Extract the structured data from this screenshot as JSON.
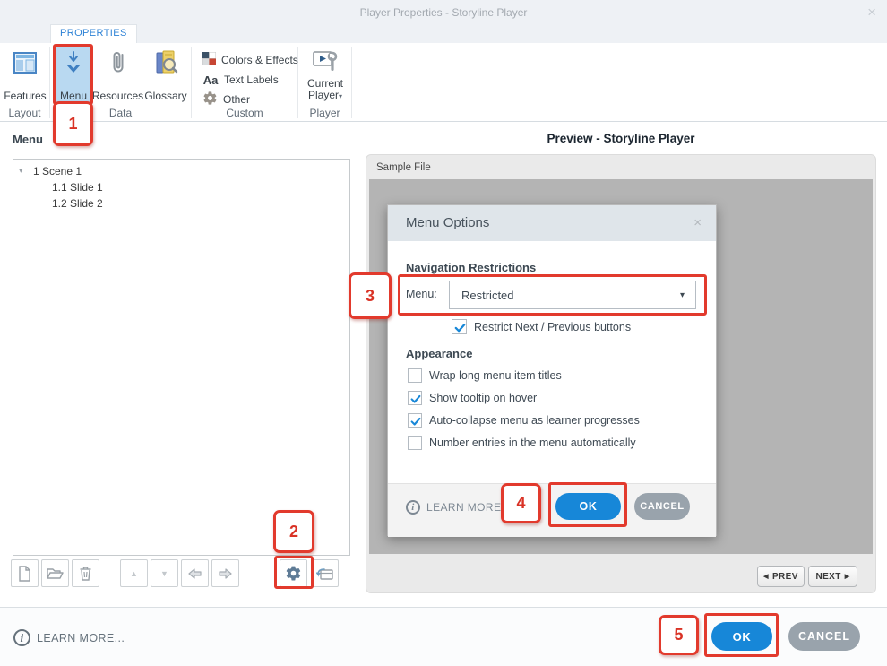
{
  "titlebar": {
    "title": "Player Properties - Storyline Player"
  },
  "ribbon": {
    "tab": "PROPERTIES",
    "features": "Features",
    "menu": "Menu",
    "resources": "Resources",
    "glossary": "Glossary",
    "colors_effects": "Colors & Effects",
    "text_labels": "Text Labels",
    "other": "Other",
    "current_player_line1": "Current",
    "current_player_line2": "Player",
    "groups": {
      "layout": "Layout",
      "data": "Data",
      "custom": "Custom",
      "player": "Player"
    }
  },
  "menu_panel": {
    "heading": "Menu",
    "tree": [
      {
        "label": "1 Scene 1"
      },
      {
        "label": "1.1 Slide 1"
      },
      {
        "label": "1.2 Slide 2"
      }
    ]
  },
  "preview": {
    "heading": "Preview - Storyline Player",
    "sample_file": "Sample File",
    "prev": "PREV",
    "next": "NEXT"
  },
  "dialog": {
    "title": "Menu Options",
    "nav_heading": "Navigation Restrictions",
    "menu_label": "Menu:",
    "menu_value": "Restricted",
    "restrict_label": "Restrict Next / Previous buttons",
    "restrict_checked": true,
    "appearance_heading": "Appearance",
    "options": [
      {
        "label": "Wrap long menu item titles",
        "checked": false
      },
      {
        "label": "Show tooltip on hover",
        "checked": true
      },
      {
        "label": "Auto-collapse menu as learner progresses",
        "checked": true
      },
      {
        "label": "Number entries in the menu automatically",
        "checked": false
      }
    ],
    "learn_more": "LEARN MORE",
    "ok": "OK",
    "cancel": "CANCEL"
  },
  "footer": {
    "learn_more": "LEARN MORE...",
    "ok": "OK",
    "cancel": "CANCEL"
  },
  "annotations": [
    "1",
    "2",
    "3",
    "4",
    "5"
  ],
  "icons": {
    "close": "×",
    "dialog_close": "×",
    "dropdown_caret": "▾",
    "current_player_caret": "▾",
    "tree_expander": "▾",
    "prev_arrow": "◀",
    "next_arrow": "▶",
    "info": "i",
    "text_labels_glyph": "Aa",
    "up_triangle": "▲",
    "down_triangle": "▼"
  },
  "colors": {
    "accent_blue": "#1787d8",
    "annotation_red": "#e23a2d",
    "menu_highlight": "#b9d9f1",
    "check_blue": "#1787d8"
  }
}
